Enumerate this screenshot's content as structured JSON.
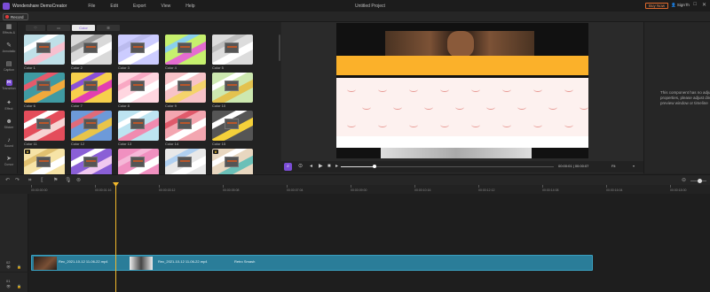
{
  "app": {
    "name": "Wondershare DemoCreator",
    "menu": [
      "File",
      "Edit",
      "Export",
      "View",
      "Help"
    ],
    "project_title": "Untitled Project",
    "buy_now": "Buy Now",
    "sign_in": "Sign In",
    "window_controls": [
      "−",
      "□",
      "✕"
    ]
  },
  "record": {
    "label": "Record"
  },
  "sidebar": {
    "items": [
      {
        "label": "Effects &",
        "icon": "effects-icon"
      },
      {
        "label": "Annotatio",
        "icon": "annotation-icon"
      },
      {
        "label": "Caption",
        "icon": "caption-icon"
      },
      {
        "label": "Transition",
        "icon": "transition-icon"
      },
      {
        "label": "Effect",
        "icon": "effect-icon"
      },
      {
        "label": "Sticker",
        "icon": "sticker-icon"
      },
      {
        "label": "Sound",
        "icon": "sound-icon"
      },
      {
        "label": "Cursor",
        "icon": "cursor-icon"
      }
    ]
  },
  "library": {
    "tabs": [
      "♡",
      "▭",
      "Color",
      "☰"
    ],
    "active_tab": "Color",
    "tiles": [
      {
        "label": "Color 1",
        "bg": "#bfe0e8",
        "a": "#f7c0cf",
        "b": "#ffffff",
        "crown": false
      },
      {
        "label": "Color 2",
        "bg": "#d9d9d9",
        "a": "#ffffff",
        "b": "#9a9a9a",
        "crown": false
      },
      {
        "label": "Color 3",
        "bg": "#ccccff",
        "a": "#ffffff",
        "b": "#bbbbee",
        "crown": false
      },
      {
        "label": "Color 4",
        "bg": "#c6f06e",
        "a": "#e46dd0",
        "b": "#8ad0ee",
        "crown": false
      },
      {
        "label": "Color 5",
        "bg": "#dcdcdc",
        "a": "#ffffff",
        "b": "#bdbdbd",
        "crown": false
      },
      {
        "label": "Color 6",
        "bg": "#3f9aa2",
        "a": "#f1a93c",
        "b": "#e55a6b",
        "crown": false
      },
      {
        "label": "Color 7",
        "bg": "#f7d04c",
        "a": "#e23fb0",
        "b": "#8a4fd8",
        "crown": false
      },
      {
        "label": "Color 8",
        "bg": "#ffd6e0",
        "a": "#ffffff",
        "b": "#f9a8c3",
        "crown": false
      },
      {
        "label": "Color 9",
        "bg": "#f7c3c8",
        "a": "#f5d36b",
        "b": "#ffffff",
        "crown": false
      },
      {
        "label": "Color 10",
        "bg": "#cde8b0",
        "a": "#e3c24f",
        "b": "#ffffff",
        "crown": false
      },
      {
        "label": "Color 11",
        "bg": "#e44d5b",
        "a": "#f7d3d3",
        "b": "#ffffff",
        "crown": false
      },
      {
        "label": "Color 12",
        "bg": "#6d9ad9",
        "a": "#e8c44a",
        "b": "#e06b7a",
        "crown": false
      },
      {
        "label": "Color 13",
        "bg": "#bde4f1",
        "a": "#f08bb0",
        "b": "#ffffff",
        "crown": false
      },
      {
        "label": "Color 14",
        "bg": "#f3a6b0",
        "a": "#ffffff",
        "b": "#e05a6b",
        "crown": false
      },
      {
        "label": "Color 15",
        "bg": "#555555",
        "a": "#f5d13a",
        "b": "#ffffff",
        "crown": false
      },
      {
        "label": "Color 16",
        "bg": "#f6e3a6",
        "a": "#ffffff",
        "b": "#e0c070",
        "crown": true
      },
      {
        "label": "Color 17",
        "bg": "#8a5fd6",
        "a": "#f0c8f0",
        "b": "#ffffff",
        "crown": false
      },
      {
        "label": "Color 18",
        "bg": "#f090c0",
        "a": "#ffffff",
        "b": "#f5b8d8",
        "crown": false
      },
      {
        "label": "Color 19",
        "bg": "#e8e8e8",
        "a": "#ffffff",
        "b": "#b0d0f0",
        "crown": false
      },
      {
        "label": "Color 20",
        "bg": "#e8d7c0",
        "a": "#6bc0b8",
        "b": "#ffffff",
        "crown": true
      },
      {
        "label": "",
        "bg": "#f7f0c0",
        "a": "#ffffff",
        "b": "#e0d090",
        "crown": false
      },
      {
        "label": "",
        "bg": "#7a4fd0",
        "a": "#f0c8f0",
        "b": "#ffffff",
        "crown": true
      },
      {
        "label": "",
        "bg": "#f4f4f4",
        "a": "#b0e0f0",
        "b": "#ffffff",
        "crown": false
      },
      {
        "label": "",
        "bg": "#cfe8f0",
        "a": "#ffffff",
        "b": "#a0c0e0",
        "crown": false
      },
      {
        "label": "",
        "bg": "#e8f0d0",
        "a": "#d0a0c0",
        "b": "#ffffff",
        "crown": false
      }
    ]
  },
  "preview": {
    "timecode": "00:00:01 | 00:00:07",
    "fit": "Fit",
    "progress": 0.16
  },
  "properties": {
    "message": "This component has no adjustable properties, please adjust directly in preview window or timeline"
  },
  "timeline": {
    "ruler": [
      "00:00:00:00",
      "00:00:01:16",
      "00:00:03:12",
      "00:00:05:08",
      "00:00:07:04",
      "00:00:09:00",
      "00:00:10:16",
      "00:00:12:12",
      "00:00:14:08",
      "00:00:16:04",
      "00:00:18:00",
      "00:00:19:16",
      "00:00:21:12"
    ],
    "tracks": [
      {
        "num": "02",
        "icons": "👁 🔒"
      },
      {
        "num": "01",
        "icons": "👁 🔒"
      }
    ],
    "clip": {
      "name1": "Rec_2021-10-12 11-06-22.mp4",
      "name2": "Rec_2021-10-12 11-06-22.mp4",
      "transition": "Retro Smash"
    }
  }
}
